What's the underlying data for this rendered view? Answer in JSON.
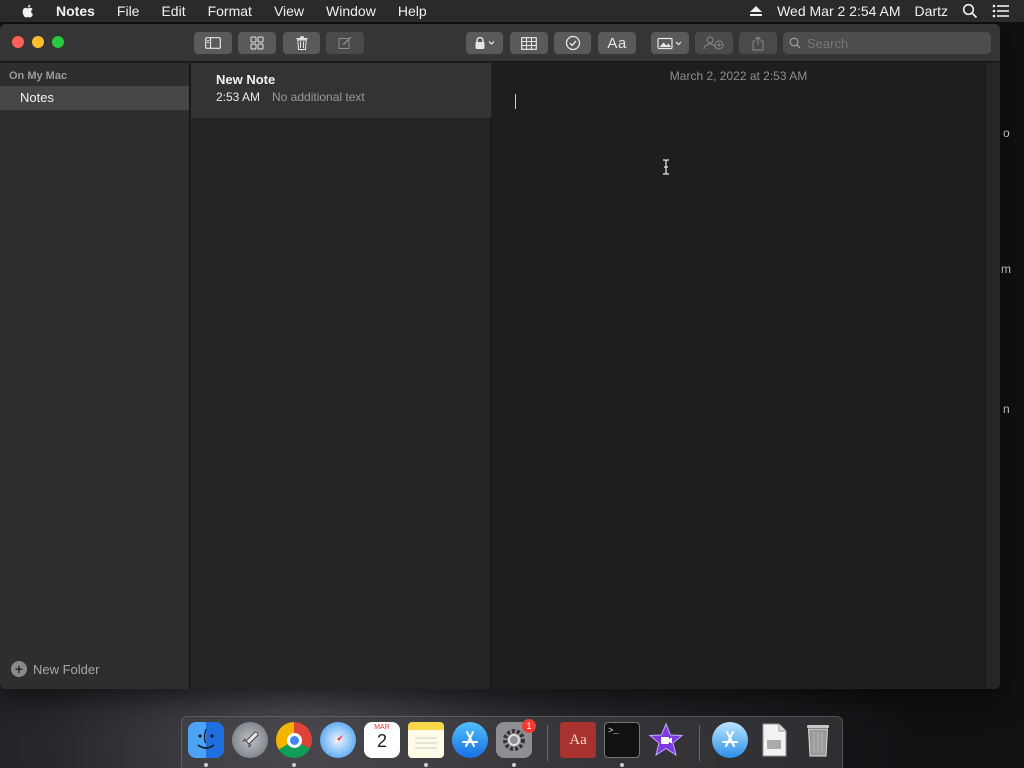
{
  "menubar": {
    "app_name": "Notes",
    "menus": [
      "File",
      "Edit",
      "Format",
      "View",
      "Window",
      "Help"
    ],
    "datetime": "Wed Mar 2  2:54 AM",
    "user": "Dartz"
  },
  "toolbar": {
    "search_placeholder": "Search",
    "text_style_label": "Aa"
  },
  "sidebar": {
    "section_title": "On My Mac",
    "folders": [
      {
        "label": "Notes",
        "selected": true
      }
    ],
    "new_folder_label": "New Folder"
  },
  "notelist": {
    "notes": [
      {
        "title": "New Note",
        "time": "2:53 AM",
        "preview": "No additional text",
        "selected": true
      }
    ]
  },
  "editor": {
    "date_label": "March 2, 2022 at 2:53 AM"
  },
  "dock": {
    "calendar_month": "MAR",
    "calendar_day": "2",
    "settings_badge": "1",
    "terminal_prompt": ">_",
    "dictionary_label": "Aa"
  },
  "desktop": {
    "peek_labels": [
      "o",
      "m",
      "n"
    ]
  }
}
